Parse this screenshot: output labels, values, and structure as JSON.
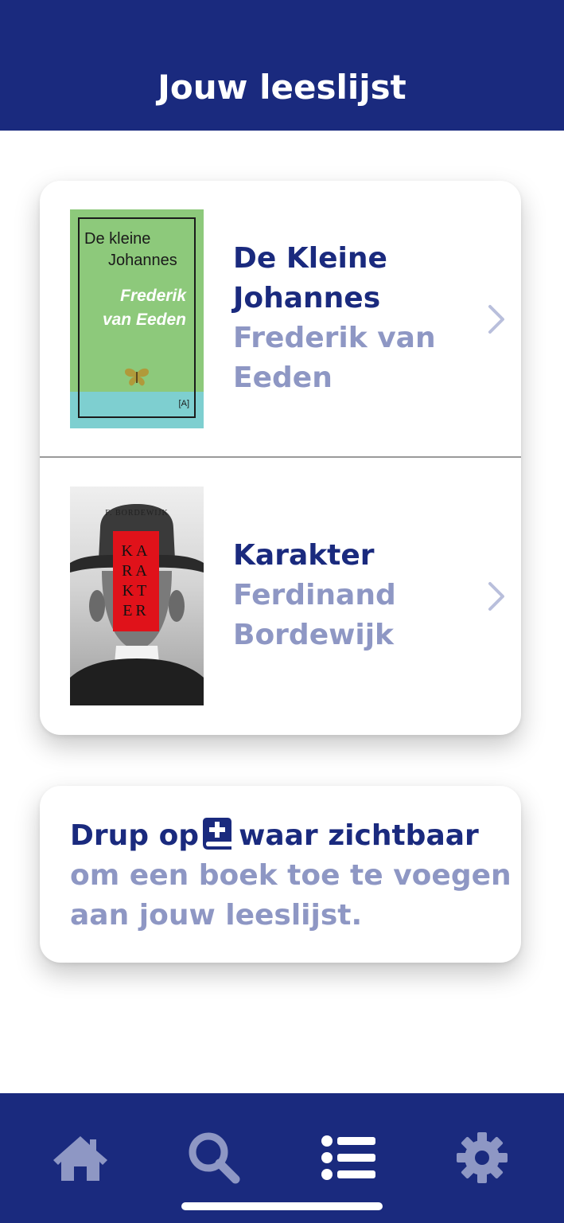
{
  "header": {
    "title": "Jouw leeslijst"
  },
  "books": [
    {
      "title": "De Kleine Johannes",
      "author": "Frederik van Eeden",
      "cover": {
        "line1": "De kleine",
        "line2": "Johannes",
        "author_line1": "Frederik",
        "author_line2": "van Eeden",
        "publisher_mark": "[A]"
      }
    },
    {
      "title": "Karakter",
      "author": "Ferdinand Bordewijk",
      "cover": {
        "author": "F. BORDEWIJK",
        "title_lines": [
          "KA",
          "RA",
          "KT",
          "ER"
        ]
      }
    }
  ],
  "info": {
    "prefix": "Drup op",
    "suffix": "waar zichtbaar",
    "rest": "om een boek toe te voegen aan jouw leeslijst.",
    "icon": "book-plus-icon"
  },
  "nav": {
    "items": [
      {
        "icon": "home-icon",
        "active": false
      },
      {
        "icon": "search-icon",
        "active": false
      },
      {
        "icon": "list-icon",
        "active": true
      },
      {
        "icon": "gear-icon",
        "active": false
      }
    ]
  },
  "colors": {
    "primary": "#1a2a7e",
    "secondary": "#8e97c4",
    "active_nav": "#ffffff",
    "inactive_nav": "#8e97c4"
  }
}
